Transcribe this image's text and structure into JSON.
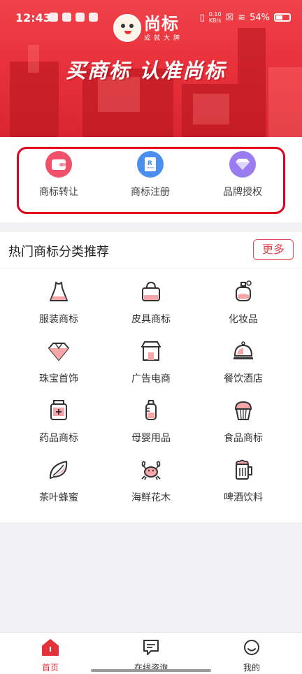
{
  "status_bar": {
    "time": "12:43",
    "net_speed_value": "0.10",
    "net_speed_unit": "KB/s",
    "battery": "54%"
  },
  "banner": {
    "logo_main": "尚标",
    "logo_sub": "成就大牌",
    "slogan": "买商标 认准尚标"
  },
  "services": [
    {
      "label": "商标转让",
      "icon": "wallet-icon",
      "color": "#f0506a"
    },
    {
      "label": "商标注册",
      "icon": "registered-document-icon",
      "color": "#4a8ff0"
    },
    {
      "label": "品牌授权",
      "icon": "diamond-icon",
      "color": "#9a7cf0"
    }
  ],
  "categories": {
    "title": "热门商标分类推荐",
    "more_label": "更多",
    "items": [
      {
        "label": "服装商标",
        "icon": "dress-icon"
      },
      {
        "label": "皮具商标",
        "icon": "handbag-icon"
      },
      {
        "label": "化妆品",
        "icon": "perfume-icon"
      },
      {
        "label": "珠宝首饰",
        "icon": "gem-icon"
      },
      {
        "label": "广告电商",
        "icon": "storefront-icon"
      },
      {
        "label": "餐饮酒店",
        "icon": "food-cloche-icon"
      },
      {
        "label": "药品商标",
        "icon": "medicine-bottle-icon"
      },
      {
        "label": "母婴用品",
        "icon": "baby-bottle-icon"
      },
      {
        "label": "食品商标",
        "icon": "cupcake-icon"
      },
      {
        "label": "茶叶蜂蜜",
        "icon": "tea-leaf-icon"
      },
      {
        "label": "海鲜花木",
        "icon": "crab-icon"
      },
      {
        "label": "啤酒饮料",
        "icon": "beer-mug-icon"
      }
    ]
  },
  "tabbar": [
    {
      "label": "首页",
      "icon": "home-icon",
      "active": true
    },
    {
      "label": "在线咨询",
      "icon": "chat-icon",
      "active": false
    },
    {
      "label": "我的",
      "icon": "profile-icon",
      "active": false
    }
  ],
  "colors": {
    "brand_red": "#e9323c",
    "highlight_border": "#e3001b",
    "accent_red": "#e2474d",
    "icon_pink": "#f6a6a8"
  }
}
